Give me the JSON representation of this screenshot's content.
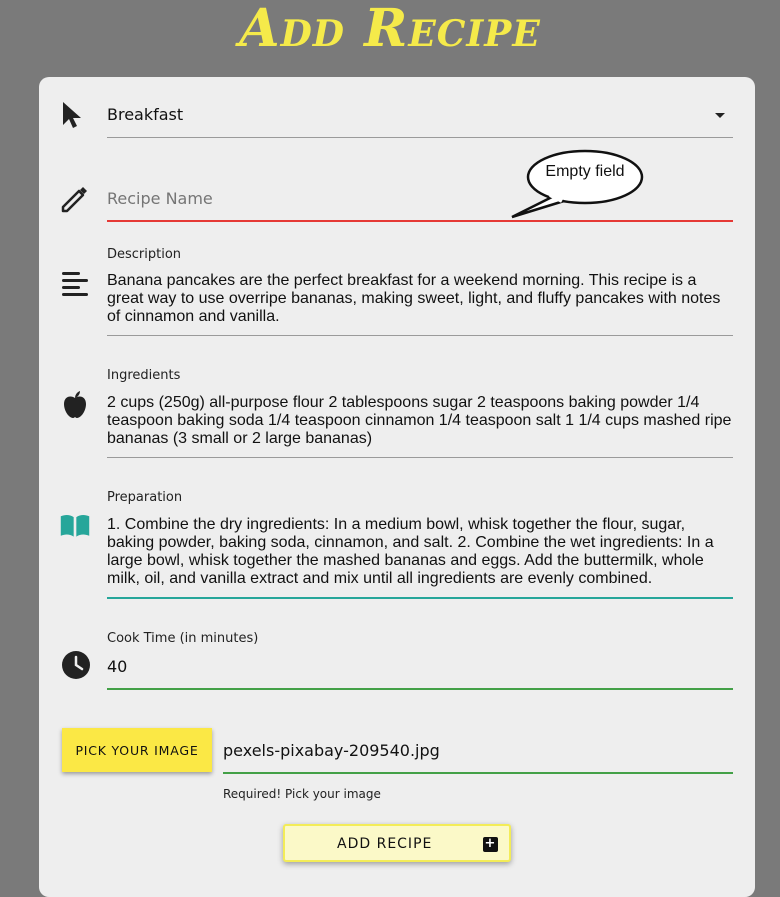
{
  "page_title": "Add Recipe",
  "category": {
    "selected": "Breakfast"
  },
  "recipe_name": {
    "placeholder": "Recipe Name",
    "error_bubble": "Empty field"
  },
  "description": {
    "label": "Description",
    "value": "Banana pancakes are the perfect breakfast for a weekend morning. This recipe is a great way to use overripe bananas, making sweet, light, and fluffy pancakes with notes of cinnamon and vanilla."
  },
  "ingredients": {
    "label": "Ingredients",
    "value": "2 cups (250g) all-purpose flour 2 tablespoons sugar 2 teaspoons baking powder 1/4 teaspoon baking soda 1/4 teaspoon cinnamon 1/4 teaspoon salt 1 1/4 cups mashed ripe bananas (3 small or 2 large bananas)"
  },
  "preparation": {
    "label": "Preparation",
    "value": "1. Combine the dry ingredients: In a medium bowl, whisk together the flour, sugar, baking powder, baking soda, cinnamon, and salt. 2. Combine the wet ingredients: In a large bowl, whisk together the mashed bananas and eggs. Add the buttermilk, whole milk, oil, and vanilla extract and mix until all ingredients are evenly combined."
  },
  "cook_time": {
    "label": "Cook Time (in minutes)",
    "value": "40"
  },
  "image": {
    "button_label": "PICK YOUR IMAGE",
    "filename": "pexels-pixabay-209540.jpg",
    "helper_text": "Required! Pick your image"
  },
  "submit": {
    "label": "ADD RECIPE"
  },
  "colors": {
    "title": "#f5ea4a",
    "error": "#e53935",
    "focus": "#26a69a",
    "valid": "#43a047",
    "button": "#fbe845"
  }
}
